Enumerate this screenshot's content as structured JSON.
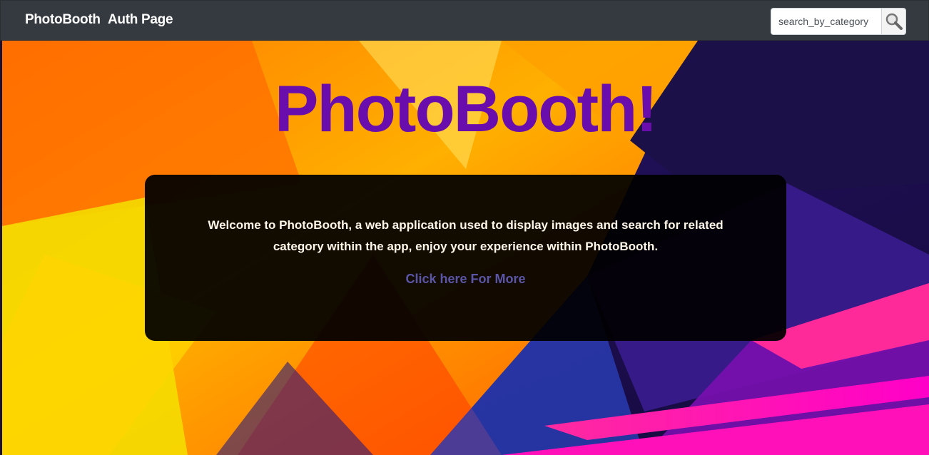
{
  "navbar": {
    "brand": "PhotoBooth",
    "links": [
      {
        "label": "Auth Page"
      }
    ],
    "search": {
      "placeholder": "search_by_category",
      "button_icon": "search-icon"
    }
  },
  "hero": {
    "title": "PhotoBooth!",
    "description": "Welcome to PhotoBooth, a web application used to display images and search for related category within the app, enjoy your experience within PhotoBooth.",
    "link_label": "Click here For More"
  },
  "colors": {
    "navbar_bg": "#343a40",
    "title": "#6a0dad",
    "link": "#5b55a8",
    "card_bg": "#000000"
  }
}
